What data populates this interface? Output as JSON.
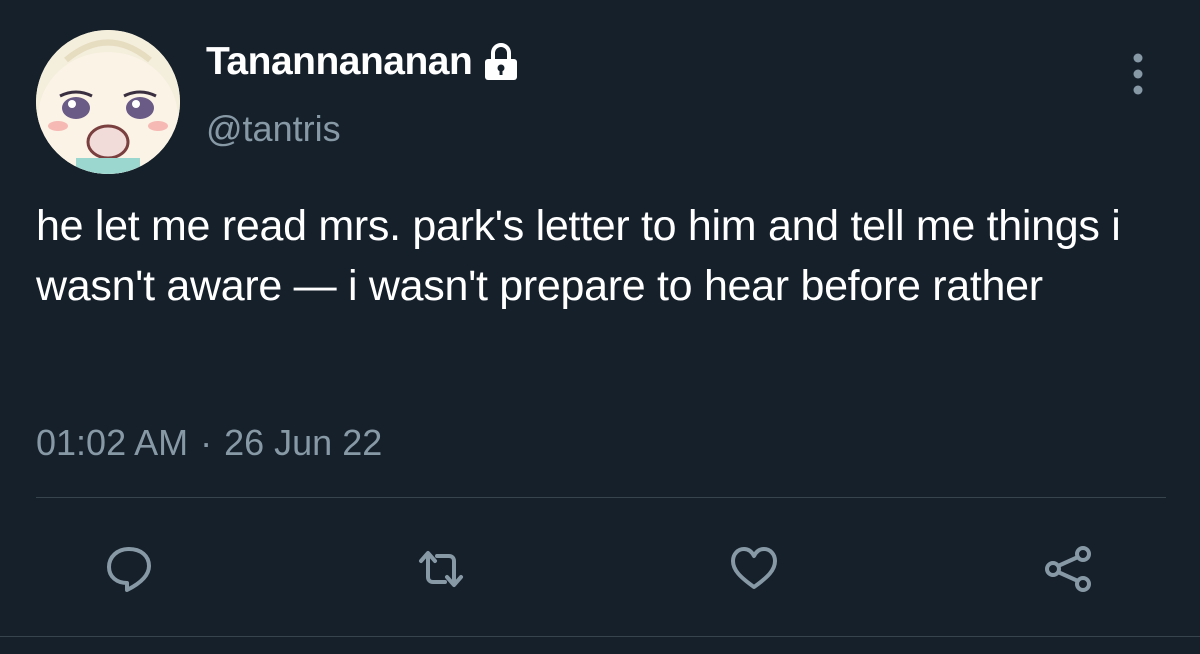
{
  "user": {
    "display_name": "Tanannananan",
    "handle": "@tantris",
    "protected_icon": "lock-icon",
    "avatar": "avatar-illustration"
  },
  "tweet": {
    "text": "he let me read mrs. park's letter to him and tell me things i wasn't aware — i wasn't prepare to hear before rather",
    "time": "01:02 AM",
    "separator": "·",
    "date": "26 Jun 22"
  },
  "actions": [
    {
      "icon": "reply-icon"
    },
    {
      "icon": "retweet-icon"
    },
    {
      "icon": "like-icon"
    },
    {
      "icon": "share-icon"
    }
  ],
  "colors": {
    "background": "#15202b",
    "primary_text": "#ffffff",
    "secondary_text": "#8899a6",
    "divider": "#38444d"
  }
}
